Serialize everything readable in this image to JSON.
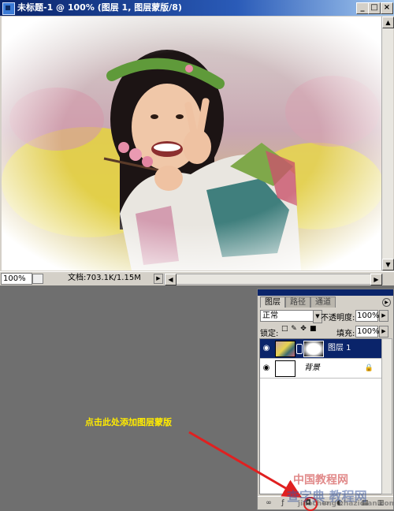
{
  "document_window": {
    "title": "未标题-1 @ 100% (图层 1, 图层蒙版/8)",
    "controls": {
      "minimize": "_",
      "maximize": "□",
      "close": "×"
    },
    "status": {
      "zoom": "100%",
      "doc_info": "文档:703.1K/1.15M"
    }
  },
  "layers_panel": {
    "tabs": [
      "图层",
      "路径",
      "通道"
    ],
    "active_tab": "图层",
    "blend_mode": "正常",
    "opacity_label": "不透明度:",
    "opacity_value": "100%",
    "lock_label": "锁定:",
    "fill_label": "填充:",
    "fill_value": "100%",
    "layers": [
      {
        "name": "图层 1",
        "selected": true,
        "has_mask": true
      },
      {
        "name": "背景",
        "selected": false,
        "locked": true
      }
    ],
    "bottom_icons": [
      "link-icon",
      "layer-style-icon",
      "add-layer-mask-icon",
      "new-set-icon",
      "adjustment-layer-icon",
      "new-layer-icon",
      "trash-icon"
    ]
  },
  "annotation": {
    "text": "点击此处添加图层蒙版",
    "color": "#ffeb00",
    "arrow_color": "#e02020"
  },
  "watermark": {
    "line1": "中国教程网",
    "line2": "查字典 教程网",
    "line3": "jiaocheng.chazidian.com"
  },
  "colors": {
    "workspace": "#6f6f6f",
    "chrome": "#d4d0c8",
    "title_active": "#0a246a",
    "selection": "#0a246a"
  }
}
